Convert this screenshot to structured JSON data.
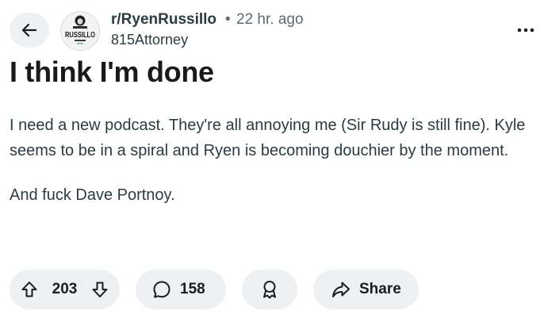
{
  "header": {
    "back_icon": "arrow-left-icon",
    "community_avatar_text": "RUSSILLO",
    "community_avatar_small_text": "RYEN",
    "subreddit": "r/RyenRussillo",
    "separator": "•",
    "time_ago": "22 hr. ago",
    "author": "815Attorney",
    "more_icon": "more-horizontal-icon"
  },
  "post": {
    "title": "I think I'm done",
    "body": [
      "I need a new podcast. They're all annoying me (Sir Rudy is still fine). Kyle seems to be in a spiral and Ryen is becoming douchier by the moment.",
      "And fuck Dave Portnoy."
    ]
  },
  "actions": {
    "upvote_icon": "upvote-arrow-icon",
    "score": "203",
    "downvote_icon": "downvote-arrow-icon",
    "comment_icon": "comment-bubble-icon",
    "comment_count": "158",
    "award_icon": "award-ribbon-icon",
    "share_icon": "share-arrow-icon",
    "share_label": "Share"
  },
  "colors": {
    "pill_background": "#eef1f3",
    "text_primary": "#1a1a1b",
    "text_secondary": "#5c6c74",
    "body_text": "#2a3c42"
  }
}
